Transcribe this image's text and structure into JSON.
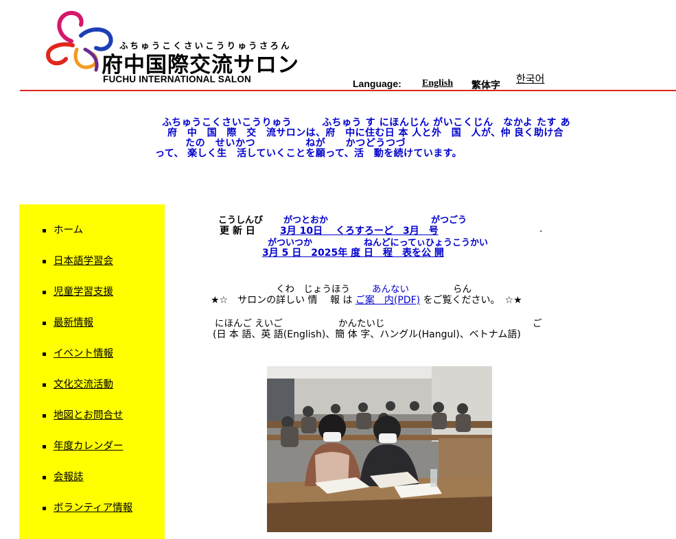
{
  "header": {
    "logo_ruby": "ふちゅうこくさいこうりゅうさろん",
    "logo_title": "府中国際交流サロン",
    "logo_english": "FUCHU INTERNATIONAL SALON",
    "language_label": "Language:",
    "languages": [
      "English",
      "繁体字",
      "한국어"
    ]
  },
  "intro": {
    "line1": "ふちゅうこくさいこうりゅう　　　ふちゅう す にほんじん がいこくじん　なかよ たす あ",
    "line2": "府　中　国　際　交　流サロンは、府　中に住む日 本 人と外　国　人が、仲 良く助け合",
    "line3": "たの　せいかつ　　　　　ねが　　かつどうつづ",
    "line4": "って、 楽しく生　活していくことを願って、活　動を続けています。"
  },
  "sidebar": {
    "items": [
      {
        "label": "ホーム",
        "link": false
      },
      {
        "label": "日本語学習会",
        "link": true
      },
      {
        "label": "児童学習支援",
        "link": true
      },
      {
        "label": "最新情報",
        "link": true
      },
      {
        "label": "イベント情報",
        "link": true
      },
      {
        "label": "文化交流活動",
        "link": true
      },
      {
        "label": "地図とお問合せ",
        "link": true
      },
      {
        "label": "年度カレンダー",
        "link": true
      },
      {
        "label": "会報誌",
        "link": true
      },
      {
        "label": "ボランティア情報",
        "link": true
      }
    ]
  },
  "update": {
    "ruby1_a": "こうしんび",
    "ruby1_b": "がつとおか",
    "ruby1_c": "がつごう",
    "label": "更 新 日",
    "link1": "3月 10日　 くろすろーど　3月　号",
    "dot": ".",
    "ruby2_a": "がついつか",
    "ruby2_b": "ねんどにってぃひょうこうかい",
    "link2": "3月 5 日　2025年 度 日　程　表を公 開"
  },
  "guide": {
    "ruby_a": "くわ　じょうほう",
    "ruby_b": "あんない",
    "ruby_c": "らん",
    "prefix": "★☆　サロンの詳しい 情　 報 は",
    "link": "ご案　内(PDF)",
    "suffix": "をご覧ください。　☆★"
  },
  "languages_note": {
    "ruby_a": "にほんご えいご",
    "ruby_b": "かんたいじ",
    "ruby_c": "ご",
    "text": "(日 本 語、英 語(English)、簡 体 字、ハングル(Hangul)、ベトナム語)"
  },
  "photo": {
    "caption": ""
  }
}
